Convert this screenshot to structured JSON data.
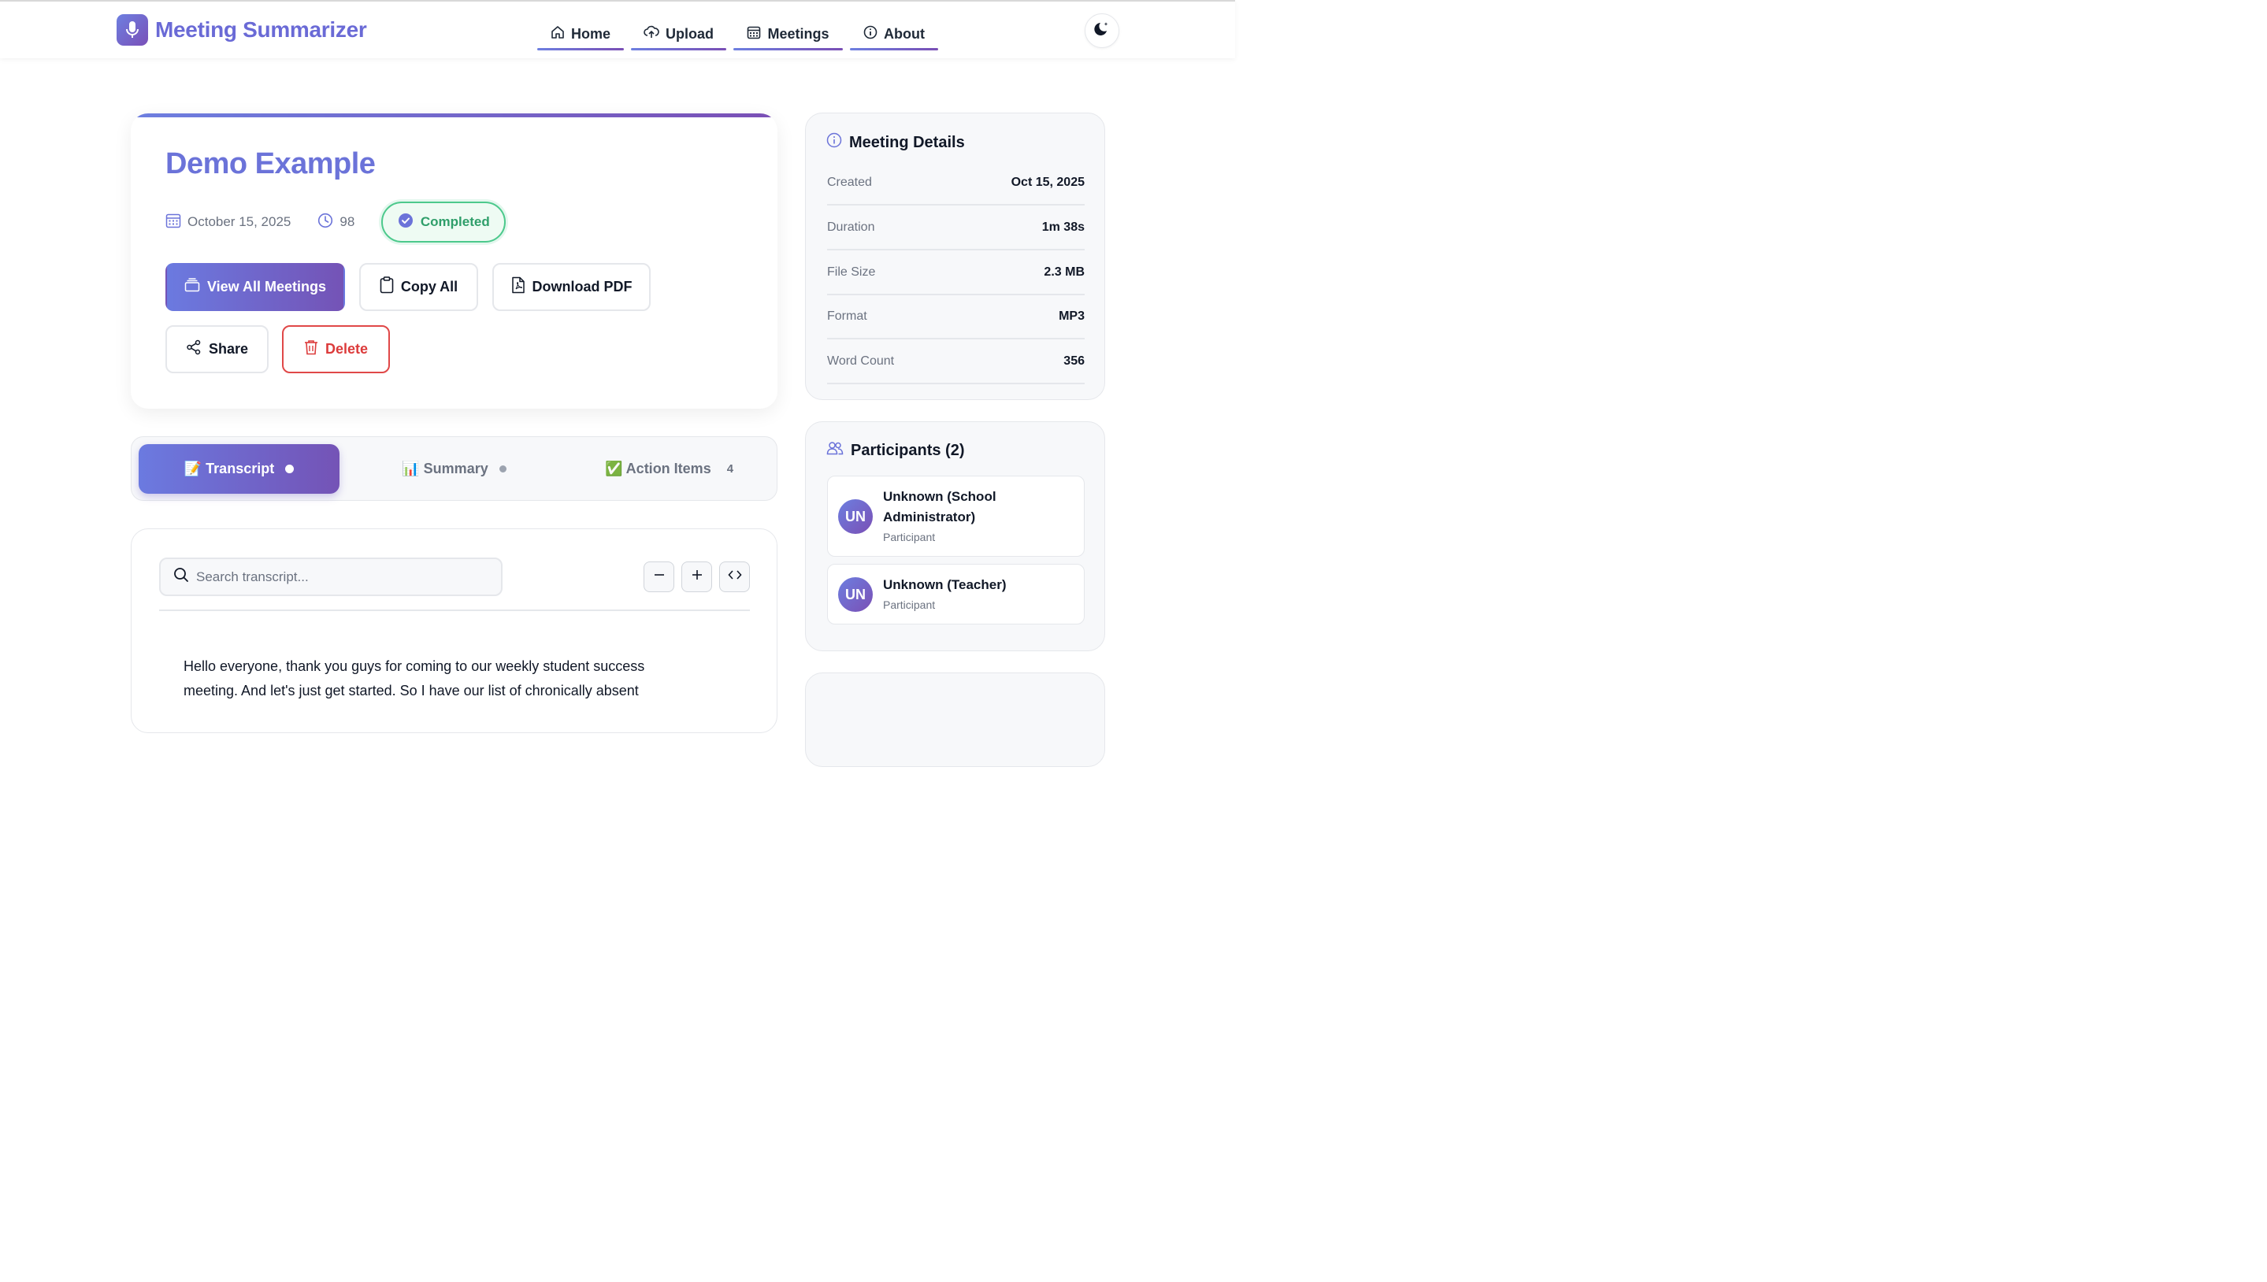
{
  "app": {
    "title": "Meeting Summarizer"
  },
  "nav": [
    {
      "label": "Home",
      "icon": "home-icon"
    },
    {
      "label": "Upload",
      "icon": "cloud-upload-icon"
    },
    {
      "label": "Meetings",
      "icon": "calendar-icon"
    },
    {
      "label": "About",
      "icon": "info-icon"
    }
  ],
  "meeting": {
    "title": "Demo Example",
    "date": "October 15, 2025",
    "duration": "98",
    "status": "Completed"
  },
  "actions": {
    "view_all": "View All Meetings",
    "copy_all": "Copy All",
    "download_pdf": "Download PDF",
    "share": "Share",
    "delete": "Delete"
  },
  "tabs": [
    {
      "label": "📝 Transcript",
      "active": true
    },
    {
      "label": "📊 Summary",
      "active": false
    },
    {
      "label": "✅ Action Items",
      "active": false,
      "count": "4"
    }
  ],
  "transcript": {
    "search_placeholder": "Search transcript...",
    "text": "Hello everyone, thank you guys for coming to our weekly student success meeting. And let's just get started. So I have our list of chronically absent"
  },
  "details": {
    "title": "Meeting Details",
    "rows": [
      {
        "key": "Created",
        "value": "Oct 15, 2025"
      },
      {
        "key": "Duration",
        "value": "1m 38s"
      },
      {
        "key": "File Size",
        "value": "2.3 MB"
      },
      {
        "key": "Format",
        "value": "MP3"
      },
      {
        "key": "Word Count",
        "value": "356"
      }
    ]
  },
  "participants": {
    "title": "Participants (2)",
    "items": [
      {
        "initials": "UN",
        "name": "Unknown (School Administrator)",
        "role": "Participant"
      },
      {
        "initials": "UN",
        "name": "Unknown (Teacher)",
        "role": "Participant"
      }
    ]
  },
  "colors": {
    "accent": "#6b73d9",
    "accent_end": "#7453b6",
    "success": "#2f9e6a",
    "danger": "#dc3b3b"
  }
}
